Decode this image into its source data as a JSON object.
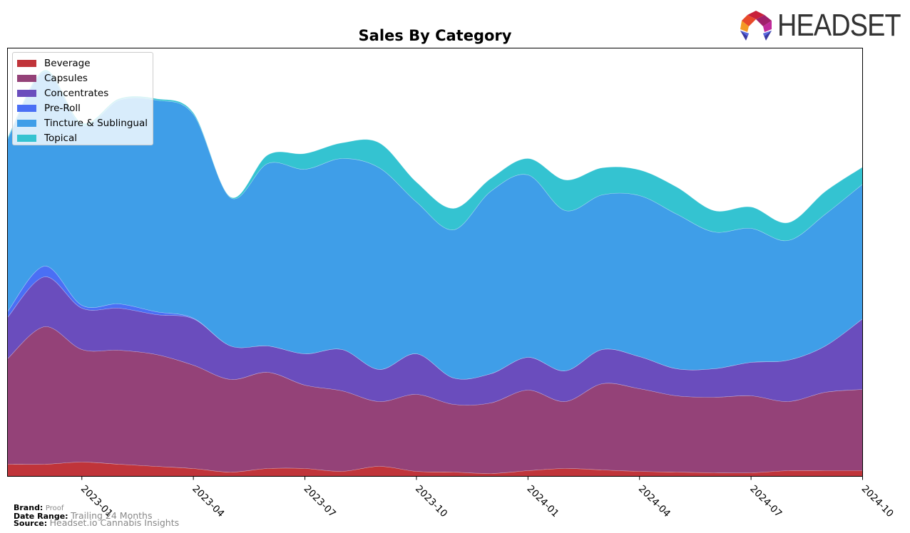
{
  "logo": {
    "text": "HEADSET"
  },
  "footer": {
    "brand_key": "Brand:",
    "brand_val": "Proof",
    "range_key": "Date Range:",
    "range_val": "Trailing 24 Months",
    "source_key": "Source:",
    "source_val": "Headset.io Cannabis Insights"
  },
  "chart_data": {
    "type": "area",
    "stacked": true,
    "smoothed": true,
    "title": "Sales By Category",
    "xlabel": "",
    "ylabel": "",
    "y_ticks_shown": false,
    "ylim": [
      0,
      601
    ],
    "grid": false,
    "legend_position": "top-left",
    "x": [
      "2022-11",
      "2022-12",
      "2023-01",
      "2023-02",
      "2023-03",
      "2023-04",
      "2023-05",
      "2023-06",
      "2023-07",
      "2023-08",
      "2023-09",
      "2023-10",
      "2023-11",
      "2023-12",
      "2024-01",
      "2024-02",
      "2024-03",
      "2024-04",
      "2024-05",
      "2024-06",
      "2024-07",
      "2024-08",
      "2024-09",
      "2024-10"
    ],
    "x_tick_labels": [
      "2023-01",
      "2023-04",
      "2023-07",
      "2023-10",
      "2024-01",
      "2024-04",
      "2024-07",
      "2024-10"
    ],
    "series": [
      {
        "name": "Beverage",
        "color": "#c0343a",
        "values": [
          17,
          17,
          20,
          17,
          14,
          11,
          6,
          11,
          11,
          7,
          14,
          7,
          6,
          4,
          8,
          11,
          9,
          7,
          6,
          5,
          5,
          8,
          8,
          8
        ]
      },
      {
        "name": "Capsules",
        "color": "#944278",
        "values": [
          148,
          193,
          158,
          160,
          157,
          145,
          130,
          135,
          117,
          113,
          91,
          108,
          95,
          99,
          113,
          94,
          121,
          116,
          107,
          106,
          108,
          97,
          110,
          114
        ]
      },
      {
        "name": "Concentrates",
        "color": "#6a4dbd",
        "values": [
          58,
          70,
          58,
          59,
          56,
          65,
          47,
          37,
          44,
          58,
          45,
          57,
          37,
          41,
          46,
          43,
          48,
          45,
          38,
          40,
          47,
          58,
          65,
          99
        ]
      },
      {
        "name": "Pre-Roll",
        "color": "#4a6ff5",
        "values": [
          8,
          15,
          4,
          6,
          4,
          1,
          0,
          0,
          0,
          0,
          0,
          0,
          0,
          0,
          0,
          0,
          0,
          0,
          0,
          0,
          0,
          0,
          0,
          0
        ]
      },
      {
        "name": "Tincture & Sublingual",
        "color": "#3f9ee8",
        "values": [
          242,
          273,
          253,
          286,
          297,
          286,
          208,
          256,
          259,
          268,
          283,
          213,
          208,
          256,
          256,
          225,
          217,
          226,
          217,
          192,
          188,
          168,
          185,
          189
        ]
      },
      {
        "name": "Topical",
        "color": "#34c3d1",
        "values": [
          2,
          2,
          3,
          2,
          2,
          2,
          1,
          12,
          22,
          22,
          35,
          28,
          30,
          18,
          23,
          43,
          38,
          36,
          38,
          30,
          30,
          25,
          32,
          24
        ]
      }
    ]
  }
}
